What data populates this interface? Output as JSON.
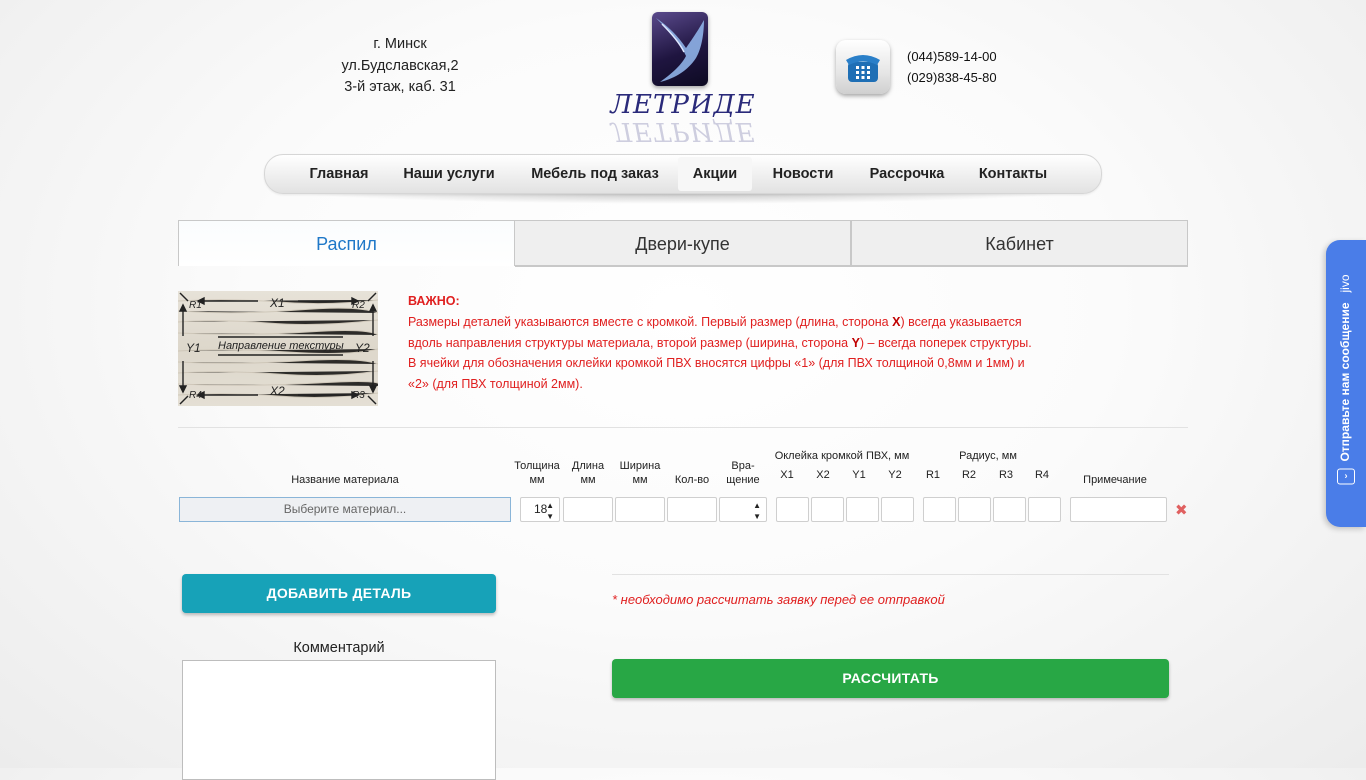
{
  "header": {
    "address_lines": [
      "г. Минск",
      "ул.Будславская,2",
      "3-й этаж, каб. 31"
    ],
    "logo_text": "ЛЕТРИДЕ",
    "phones": [
      "(044)589-14-00",
      "(029)838-45-80"
    ]
  },
  "menu": {
    "items": [
      {
        "label": "Главная"
      },
      {
        "label": "Наши услуги"
      },
      {
        "label": "Мебель под заказ"
      },
      {
        "label": "Акции"
      },
      {
        "label": "Новости"
      },
      {
        "label": "Рассрочка"
      },
      {
        "label": "Контакты"
      }
    ],
    "active": "Акции"
  },
  "tabs": [
    {
      "label": "Распил",
      "active": true
    },
    {
      "label": "Двери-купе",
      "active": false
    },
    {
      "label": "Кабинет",
      "active": false
    }
  ],
  "texture_image": {
    "labels": [
      "R1",
      "X1",
      "R2",
      "Y1",
      "Направление текстуры",
      "Y2",
      "R4",
      "X2",
      "R3"
    ]
  },
  "important": {
    "title": "ВАЖНО:",
    "line1_pre": "Размеры деталей указываются вместе с кромкой. Первый размер (длина, сторона ",
    "line1_bold": "X",
    "line1_post": ") всегда указывается",
    "line2": "вдоль направления структуры материала, второй размер (ширина, сторона ",
    "line2_bold": "Y",
    "line2_post": ") – всегда поперек структуры.",
    "line3": "В ячейки для обозначения оклейки кромкой ПВХ вносятся цифры «1» (для ПВХ толщиной 0,8мм и 1мм) и",
    "line4": "«2» (для ПВХ толщиной 2мм)."
  },
  "table": {
    "headers": {
      "material": "Название материала",
      "thickness": [
        "Толщина",
        "мм"
      ],
      "length": [
        "Длина",
        "мм"
      ],
      "width": [
        "Ширина",
        "мм"
      ],
      "qty": "Кол-во",
      "rotation": [
        "Вра-",
        "щение"
      ],
      "edge_group": "Оклейка кромкой ПВХ, мм",
      "edge_cols": [
        "X1",
        "X2",
        "Y1",
        "Y2"
      ],
      "radius_group": "Радиус, мм",
      "radius_cols": [
        "R1",
        "R2",
        "R3",
        "R4"
      ],
      "note": "Примечание"
    },
    "row": {
      "material_placeholder": "Выберите материал...",
      "thickness_value": "18"
    }
  },
  "actions": {
    "add_detail": "ДОБАВИТЬ ДЕТАЛЬ",
    "comment_label": "Комментарий",
    "calc_note": "* необходимо рассчитать заявку перед ее отправкой",
    "calculate": "РАССЧИТАТЬ"
  },
  "jivo": {
    "label": "Отправьте нам сообщение",
    "brand": "jivo"
  },
  "colors": {
    "accent_blue": "#1f78c8",
    "warning_red": "#e02020",
    "add_button": "#17a2b8",
    "calc_button": "#28a745",
    "jivo": "#4a7de8"
  }
}
